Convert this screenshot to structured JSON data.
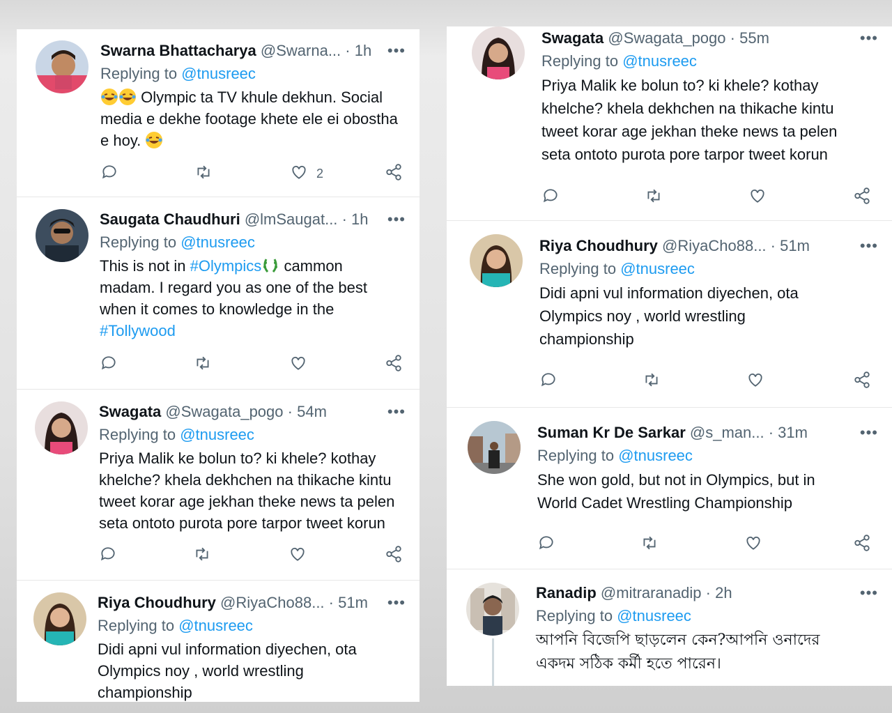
{
  "left_panel": {
    "tweets": [
      {
        "name": "Swarna Bhattacharya",
        "handle": "@Swarna...",
        "time": "1h",
        "replying_prefix": "Replying to",
        "replying_to": "@tnusreec",
        "text_line1": "Olympic ta TV khule dekhun. Social",
        "text_line2": "media e dekhe footage khete ele ei obostha",
        "text_line3": "e hoy.",
        "like_count": "2"
      },
      {
        "name": "Saugata Chaudhuri",
        "handle": "@lmSaugat...",
        "time": "1h",
        "replying_prefix": "Replying to",
        "replying_to": "@tnusreec",
        "text_start": "This is not in",
        "hashtag1": "#Olympics",
        "text_mid": "cammon",
        "text_line2": "madam. I regard you as one of the best",
        "text_line3": "when it comes to knowledge in the",
        "hashtag2": "#Tollywood"
      },
      {
        "name": "Swagata",
        "handle": "@Swagata_pogo",
        "time": "54m",
        "replying_prefix": "Replying to",
        "replying_to": "@tnusreec",
        "text_line1": "Priya Malik ke bolun to? ki khele? kothay",
        "text_line2": "khelche? khela dekhchen na thikache kintu",
        "text_line3": "tweet korar age jekhan theke news ta pelen",
        "text_line4": "seta ontoto purota pore tarpor tweet korun"
      },
      {
        "name": "Riya Choudhury",
        "handle": "@RiyaCho88...",
        "time": "51m",
        "replying_prefix": "Replying to",
        "replying_to": "@tnusreec",
        "text_line1": "Didi apni vul information diyechen, ota",
        "text_line2": "Olympics noy , world wrestling",
        "text_line3": "championship"
      }
    ]
  },
  "right_panel": {
    "tweets": [
      {
        "name": "Swagata",
        "handle": "@Swagata_pogo",
        "time": "55m",
        "replying_prefix": "Replying to",
        "replying_to": "@tnusreec",
        "text_line1": "Priya Malik ke bolun to? ki khele? kothay",
        "text_line2": "khelche? khela dekhchen na thikache kintu",
        "text_line3": "tweet korar age jekhan theke news ta pelen",
        "text_line4": "seta ontoto purota pore tarpor tweet korun"
      },
      {
        "name": "Riya Choudhury",
        "handle": "@RiyaCho88...",
        "time": "51m",
        "replying_prefix": "Replying to",
        "replying_to": "@tnusreec",
        "text_line1": "Didi apni vul information diyechen, ota",
        "text_line2": "Olympics noy , world wrestling",
        "text_line3": "championship"
      },
      {
        "name": "Suman Kr De Sarkar",
        "handle": "@s_man...",
        "time": "31m",
        "replying_prefix": "Replying to",
        "replying_to": "@tnusreec",
        "text_line1": "She won gold, but not in Olympics, but in",
        "text_line2": "World Cadet Wrestling Championship"
      },
      {
        "name": "Ranadip",
        "handle": "@mitraranadip",
        "time": "2h",
        "replying_prefix": "Replying to",
        "replying_to": "@tnusreec",
        "text_line1": "আপনি বিজেপি ছাড়লেন কেন?আপনি ওনাদের",
        "text_line2": "একদম সঠিক কর্মী হতে পারেন।"
      }
    ]
  },
  "ui": {
    "separator_dot": "·",
    "more_glyph": "•••",
    "colors": {
      "link": "#1d9bf0",
      "muted": "#536471",
      "text": "#0f1419"
    },
    "icons": [
      "reply-icon",
      "retweet-icon",
      "like-icon",
      "share-icon",
      "more-icon",
      "laughing-emoji-icon",
      "laurel-emoji-icon"
    ]
  }
}
